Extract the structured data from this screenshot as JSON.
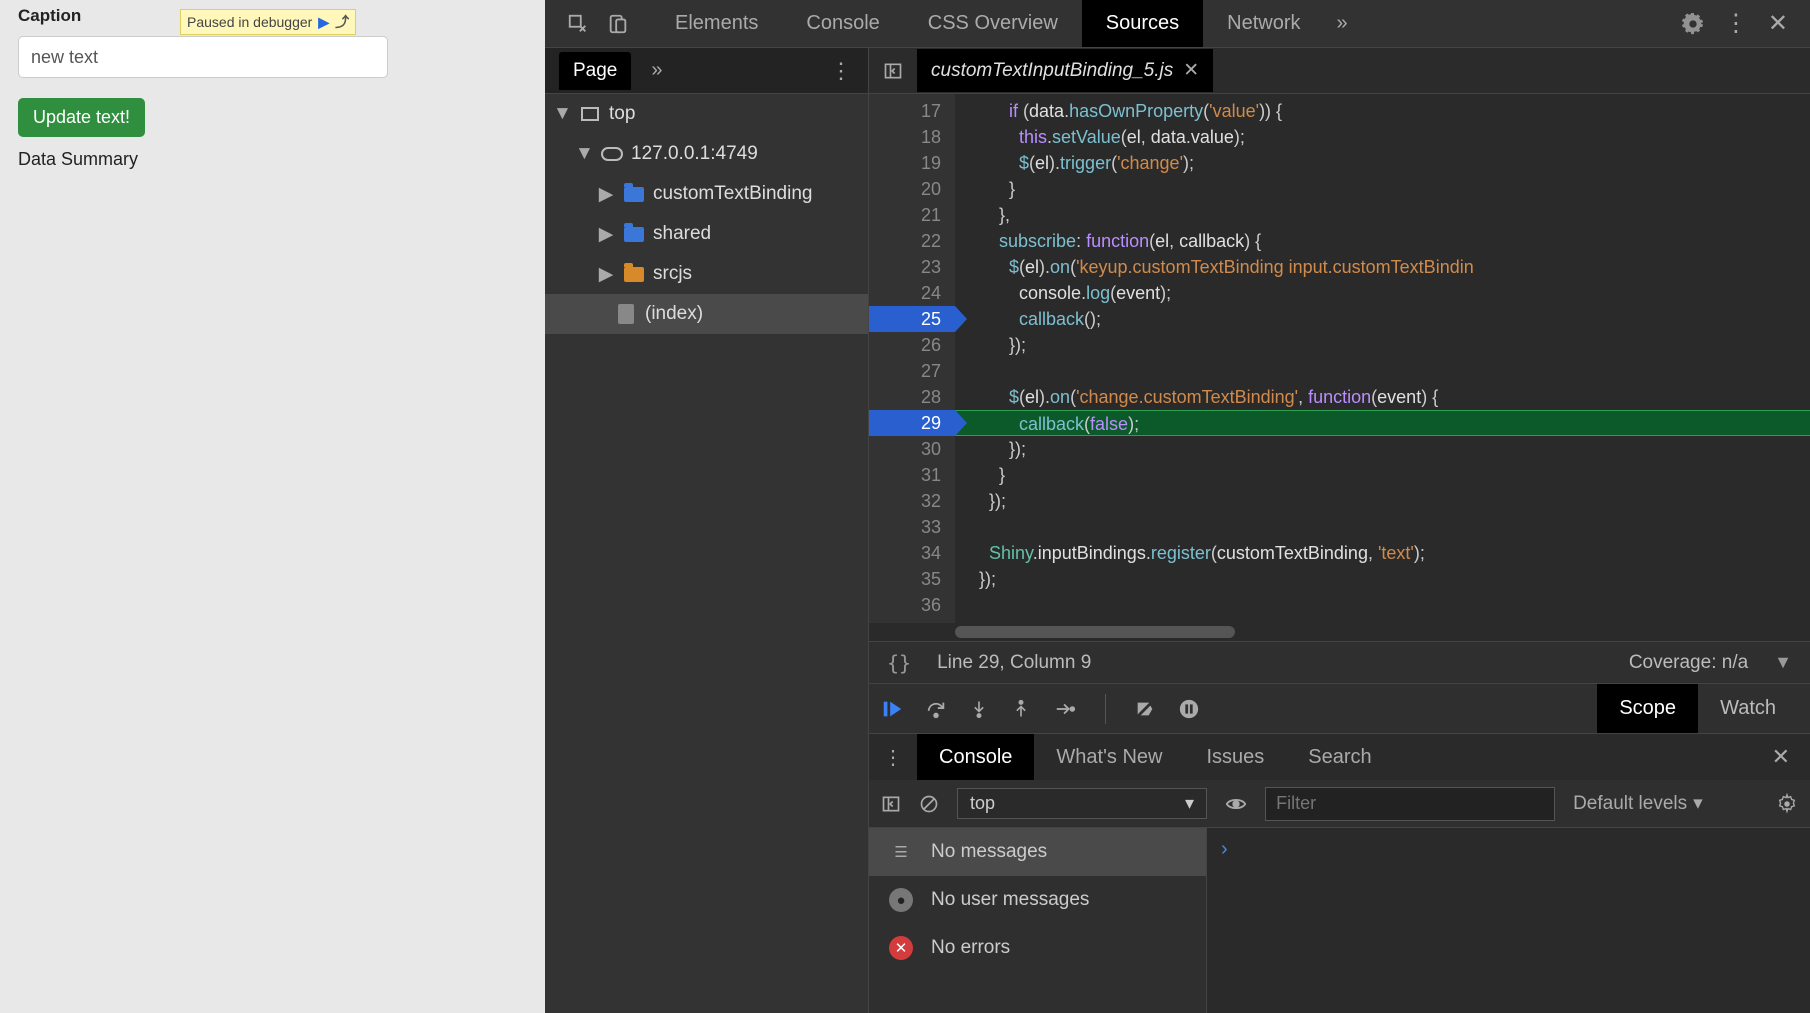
{
  "app": {
    "caption_label": "Caption",
    "caption_value": "new text",
    "update_button": "Update text!",
    "summary_label": "Data Summary",
    "debugger_badge": "Paused in debugger"
  },
  "main_tabs": {
    "items": [
      "Elements",
      "Console",
      "CSS Overview",
      "Sources",
      "Network"
    ],
    "active_index": 3,
    "more_glyph": "»"
  },
  "navigator": {
    "page_tab": "Page",
    "more_glyph": "»",
    "tree": {
      "top": "top",
      "host": "127.0.0.1:4749",
      "folders": [
        "customTextBinding",
        "shared",
        "srcjs"
      ],
      "index": "(index)"
    }
  },
  "editor": {
    "tab_name": "customTextInputBinding_5.js",
    "lines": [
      {
        "n": 17,
        "html": "        <span class='tok-kw'>if</span> <span class='tok-punc'>(</span><span class='tok-id'>data</span><span class='tok-punc'>.</span><span class='tok-fn'>hasOwnProperty</span><span class='tok-punc'>(</span><span class='tok-str'>'value'</span><span class='tok-punc'>)) {</span>"
      },
      {
        "n": 18,
        "html": "          <span class='tok-kw'>this</span><span class='tok-punc'>.</span><span class='tok-fn'>setValue</span><span class='tok-punc'>(</span><span class='tok-id'>el</span><span class='tok-punc'>, </span><span class='tok-id'>data</span><span class='tok-punc'>.</span><span class='tok-id'>value</span><span class='tok-punc'>);</span>"
      },
      {
        "n": 19,
        "html": "          <span class='tok-fn'>$</span><span class='tok-punc'>(</span><span class='tok-id'>el</span><span class='tok-punc'>).</span><span class='tok-fn'>trigger</span><span class='tok-punc'>(</span><span class='tok-str'>'change'</span><span class='tok-punc'>);</span>"
      },
      {
        "n": 20,
        "html": "        <span class='tok-punc'>}</span>"
      },
      {
        "n": 21,
        "html": "      <span class='tok-punc'>},</span>"
      },
      {
        "n": 22,
        "html": "      <span class='tok-prop'>subscribe</span><span class='tok-punc'>: </span><span class='tok-kw'>function</span><span class='tok-punc'>(</span><span class='tok-id'>el</span><span class='tok-punc'>, </span><span class='tok-id'>callback</span><span class='tok-punc'>) {</span>"
      },
      {
        "n": 23,
        "html": "        <span class='tok-fn'>$</span><span class='tok-punc'>(</span><span class='tok-id'>el</span><span class='tok-punc'>).</span><span class='tok-fn'>on</span><span class='tok-punc'>(</span><span class='tok-str'>'keyup.customTextBinding input.customTextBindin</span>"
      },
      {
        "n": 24,
        "html": "          <span class='tok-id'>console</span><span class='tok-punc'>.</span><span class='tok-fn'>log</span><span class='tok-punc'>(</span><span class='tok-id'>event</span><span class='tok-punc'>);</span>"
      },
      {
        "n": 25,
        "bp": true,
        "html": "          <span class='tok-fn'>callback</span><span class='tok-punc'>();</span>"
      },
      {
        "n": 26,
        "html": "        <span class='tok-punc'>});</span>"
      },
      {
        "n": 27,
        "html": ""
      },
      {
        "n": 28,
        "html": "        <span class='tok-fn'>$</span><span class='tok-punc'>(</span><span class='tok-id'>el</span><span class='tok-punc'>).</span><span class='tok-fn'>on</span><span class='tok-punc'>(</span><span class='tok-str'>'change.customTextBinding'</span><span class='tok-punc'>, </span><span class='tok-kw'>function</span><span class='tok-punc'>(</span><span class='tok-id'>event</span><span class='tok-punc'>) {</span>"
      },
      {
        "n": 29,
        "bp": true,
        "exec": true,
        "html": "          <span class='tok-fn'>callback</span><span class='tok-punc'>(</span><span class='tok-kw'>false</span><span class='tok-punc'>);</span>"
      },
      {
        "n": 30,
        "html": "        <span class='tok-punc'>});</span>"
      },
      {
        "n": 31,
        "html": "      <span class='tok-punc'>}</span>"
      },
      {
        "n": 32,
        "html": "    <span class='tok-punc'>});</span>"
      },
      {
        "n": 33,
        "html": ""
      },
      {
        "n": 34,
        "html": "    <span class='tok-obj'>Shiny</span><span class='tok-punc'>.</span><span class='tok-id'>inputBindings</span><span class='tok-punc'>.</span><span class='tok-fn'>register</span><span class='tok-punc'>(</span><span class='tok-id'>customTextBinding</span><span class='tok-punc'>, </span><span class='tok-str'>'text'</span><span class='tok-punc'>);</span>"
      },
      {
        "n": 35,
        "html": "  <span class='tok-punc'>});</span>"
      },
      {
        "n": 36,
        "html": ""
      }
    ],
    "status": {
      "curly": "{}",
      "cursor": "Line 29, Column 9",
      "coverage": "Coverage: n/a"
    }
  },
  "debugger": {
    "tabs": [
      "Scope",
      "Watch"
    ],
    "active_index": 0
  },
  "drawer": {
    "tabs": [
      "Console",
      "What's New",
      "Issues",
      "Search"
    ],
    "active_index": 0,
    "context": "top",
    "filter_placeholder": "Filter",
    "levels_label": "Default levels",
    "sidebar": [
      "No messages",
      "No user messages",
      "No errors"
    ],
    "prompt": "›"
  }
}
